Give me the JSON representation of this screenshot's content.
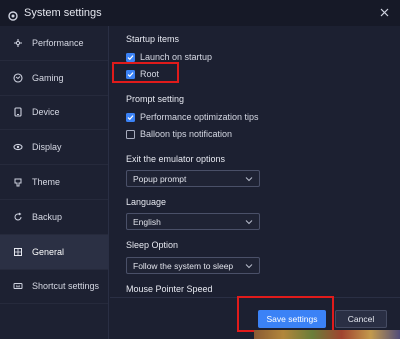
{
  "window": {
    "title": "System settings"
  },
  "sidebar": {
    "items": [
      {
        "label": "Performance",
        "icon": "performance-icon"
      },
      {
        "label": "Gaming",
        "icon": "gaming-icon"
      },
      {
        "label": "Device",
        "icon": "device-icon"
      },
      {
        "label": "Display",
        "icon": "display-icon"
      },
      {
        "label": "Theme",
        "icon": "theme-icon"
      },
      {
        "label": "Backup",
        "icon": "backup-icon"
      },
      {
        "label": "General",
        "icon": "general-icon",
        "active": true
      },
      {
        "label": "Shortcut settings",
        "icon": "shortcut-icon"
      }
    ]
  },
  "startup": {
    "heading": "Startup items",
    "launch_label": "Launch on startup",
    "launch_checked": true,
    "root_label": "Root",
    "root_checked": true
  },
  "prompt": {
    "heading": "Prompt setting",
    "perf_tips_label": "Performance optimization tips",
    "perf_tips_checked": true,
    "balloon_label": "Balloon tips notification",
    "balloon_checked": false
  },
  "exit_options": {
    "heading": "Exit the emulator options",
    "selected": "Popup prompt"
  },
  "language": {
    "heading": "Language",
    "selected": "English"
  },
  "sleep": {
    "heading": "Sleep Option",
    "selected": "Follow the system to sleep"
  },
  "mouse": {
    "heading": "Mouse Pointer Speed"
  },
  "footer": {
    "save_label": "Save settings",
    "cancel_label": "Cancel"
  },
  "colors": {
    "accent": "#3b82f6",
    "highlight": "#e01b1b",
    "background": "#1c2031"
  }
}
